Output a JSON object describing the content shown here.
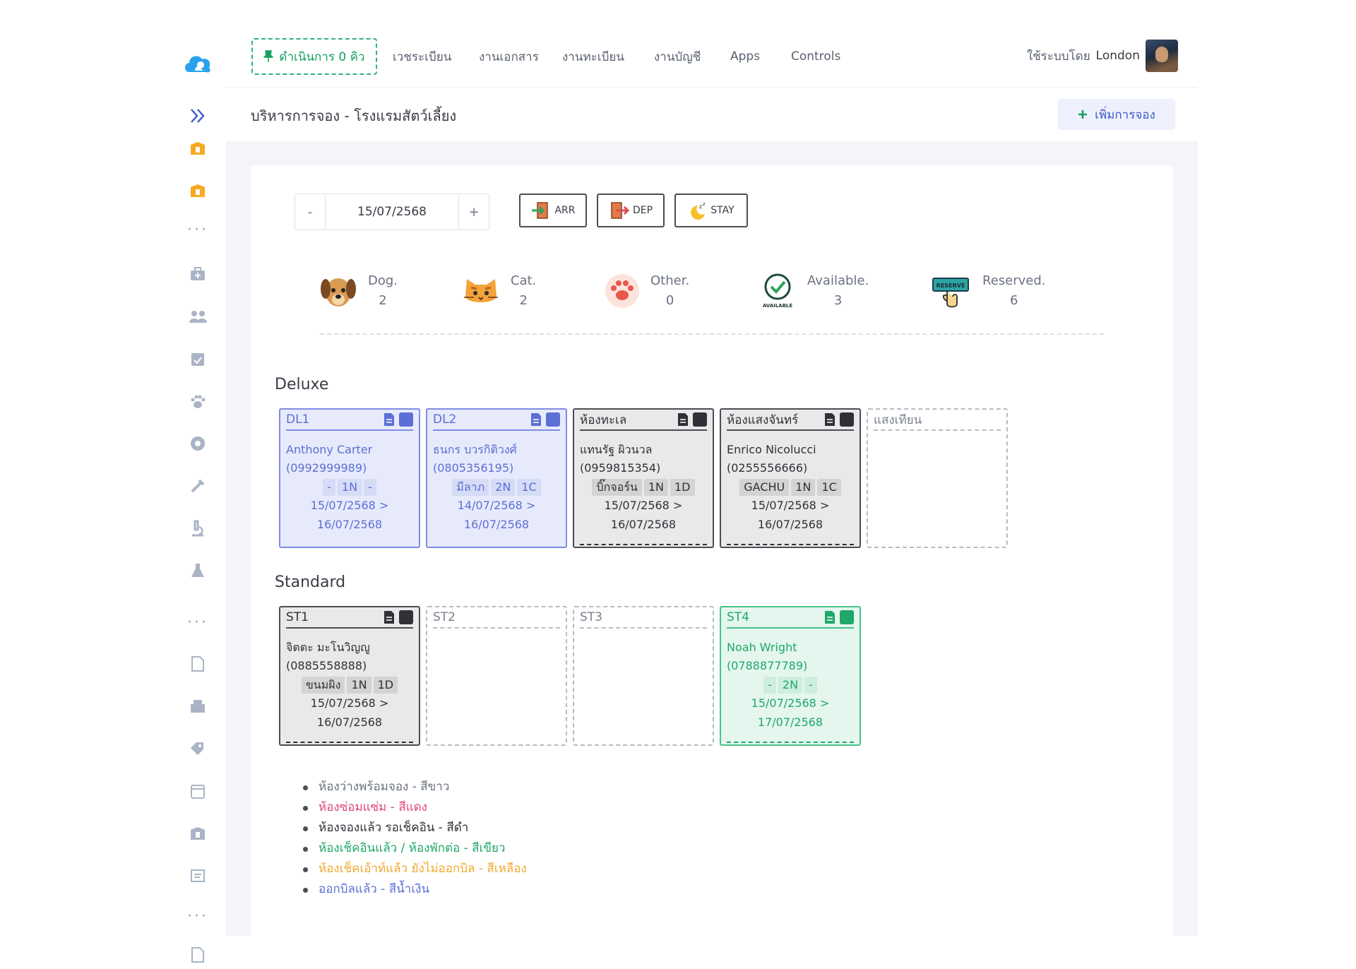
{
  "colors": {
    "blue": "#5b6fd6",
    "dark": "#2f3137",
    "green": "#1fa86a",
    "red": "#e0457b",
    "yellow": "#f0a92e",
    "gray": "#6a7280"
  },
  "sidebar": {
    "icons": [
      "app-logo-icon",
      "expand-icon",
      "clinic-icon",
      "clinic-icon",
      "more-dots",
      "briefcase-medical-icon",
      "users-icon",
      "calendar-check-icon",
      "paw-icon",
      "lifebuoy-icon",
      "syringe-icon",
      "microscope-icon",
      "flask-icon",
      "more-dots",
      "document-icon",
      "warehouse-icon",
      "tags-icon",
      "calendar-icon",
      "clinic-icon",
      "file-icon",
      "more-dots",
      "report-icon"
    ]
  },
  "topnav": {
    "queue": "ดำเนินการ 0 คิว",
    "items": [
      "เวชระเบียน",
      "งานเอกสาร",
      "งานทะเบียน",
      "งานบัญชี",
      "Apps",
      "Controls"
    ],
    "user_prefix": "ใช้ระบบโดย",
    "user_name": "London"
  },
  "page": {
    "title": "บริหารการจอง - โรงแรมสัตว์เลี้ยง",
    "add_button": "เพิ่มการจอง"
  },
  "date_stepper": {
    "minus": "-",
    "value": "15/07/2568",
    "plus": "+"
  },
  "filters": {
    "arr": "ARR",
    "dep": "DEP",
    "stay": "STAY"
  },
  "stats": [
    {
      "label": "Dog.",
      "value": "2",
      "icon": "dog-face-icon"
    },
    {
      "label": "Cat.",
      "value": "2",
      "icon": "cat-face-icon"
    },
    {
      "label": "Other.",
      "value": "0",
      "icon": "paw-print-icon"
    },
    {
      "label": "Available.",
      "value": "3",
      "icon": "available-badge-icon",
      "badge_text": "AVAILABLE"
    },
    {
      "label": "Reserved.",
      "value": "6",
      "icon": "reserve-sign-icon",
      "badge_text": "RESERVE"
    }
  ],
  "sections": {
    "deluxe": {
      "title": "Deluxe",
      "rooms": [
        {
          "code": "DL1",
          "status": "blue",
          "guest": "Anthony Carter",
          "phone": "(0992999989)",
          "tags": [
            "-",
            "1N",
            "-"
          ],
          "from": "15/07/2568 >",
          "to": "16/07/2568"
        },
        {
          "code": "DL2",
          "status": "blue",
          "guest": "ธนกร บวรกิติวงศ์",
          "phone": "(0805356195)",
          "tags": [
            "มีลาภ",
            "2N",
            "1C"
          ],
          "from": "14/07/2568 >",
          "to": "16/07/2568"
        },
        {
          "code": "ห้องทะเล",
          "status": "dark",
          "guest": "แทนรัฐ ผิวนวล",
          "phone": "(0959815354)",
          "tags": [
            "บิ๊กจอร์น",
            "1N",
            "1D"
          ],
          "from": "15/07/2568 >",
          "to": "16/07/2568"
        },
        {
          "code": "ห้องแสงจันทร์",
          "status": "dark",
          "guest": "Enrico Nicolucci",
          "phone": "(0255556666)",
          "tags": [
            "GACHU",
            "1N",
            "1C"
          ],
          "from": "15/07/2568 >",
          "to": "16/07/2568"
        },
        {
          "code": "แสงเทียน",
          "status": "empty"
        }
      ]
    },
    "standard": {
      "title": "Standard",
      "rooms": [
        {
          "code": "ST1",
          "status": "dark",
          "guest": "จิตตะ มะโนวิญญู",
          "phone": "(0885558888)",
          "tags": [
            "ขนมผิง",
            "1N",
            "1D"
          ],
          "from": "15/07/2568 >",
          "to": "16/07/2568"
        },
        {
          "code": "ST2",
          "status": "empty"
        },
        {
          "code": "ST3",
          "status": "empty"
        },
        {
          "code": "ST4",
          "status": "green",
          "guest": "Noah Wright",
          "phone": "(0788877789)",
          "tags": [
            "-",
            "2N",
            "-"
          ],
          "from": "15/07/2568 >",
          "to": "17/07/2568"
        }
      ]
    }
  },
  "legend": [
    {
      "text": "ห้องว่างพร้อมจอง - สีขาว",
      "color": "#6a7280"
    },
    {
      "text": "ห้องซ่อมแซ่ม - สีแดง",
      "color": "#e0457b"
    },
    {
      "text": "ห้องจองแล้ว รอเช็คอิน - สีดำ",
      "color": "#2f3137"
    },
    {
      "text": "ห้องเช็คอินแล้ว / ห้องพักต่อ - สีเขียว",
      "color": "#1fa86a"
    },
    {
      "text": "ห้องเช็คเอ้าท์แล้ว ยังไม่ออกบิล - สีเหลือง",
      "color": "#f0a92e"
    },
    {
      "text": "ออกบิลแล้ว - สีน้ำเงิน",
      "color": "#5b6fd6"
    }
  ]
}
